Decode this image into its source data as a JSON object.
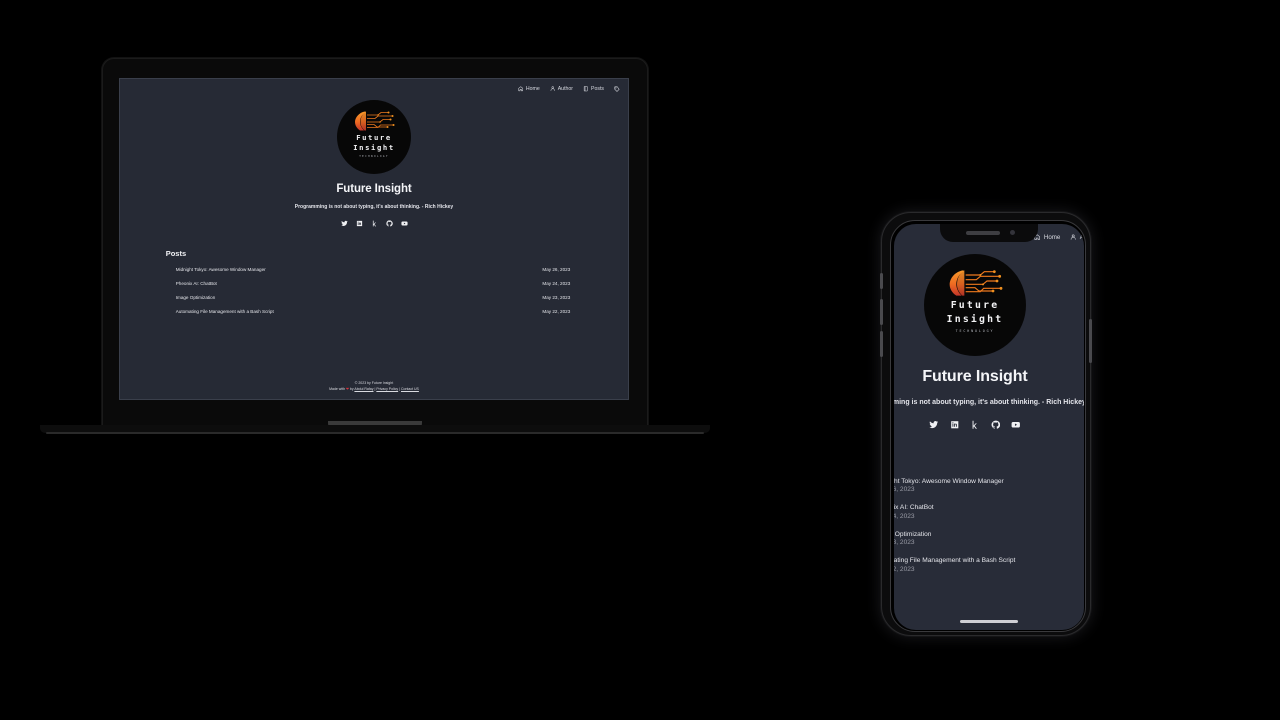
{
  "scene": {
    "background_color": "#000000",
    "devices": [
      "laptop",
      "phone"
    ]
  },
  "site": {
    "background_color": "#262a35",
    "accent_color": "#ef6c24",
    "text_color": "#e8e9ed",
    "nav": {
      "items": [
        {
          "label": "Home",
          "icon": "home-icon"
        },
        {
          "label": "Author",
          "icon": "user-icon"
        },
        {
          "label": "Posts",
          "icon": "book-icon"
        },
        {
          "label": "",
          "icon": "tag-icon"
        }
      ]
    },
    "logo": {
      "line1": "Future",
      "line2": "Insight",
      "line3": "TECHNOLOGY",
      "mark": "face-circuit-icon",
      "badge_color": "#070707"
    },
    "header": {
      "title": "Future Insight",
      "tagline": "Programming is not about typing, it's about thinking. - Rich Hickey"
    },
    "socials": [
      {
        "name": "twitter-icon"
      },
      {
        "name": "linkedin-icon"
      },
      {
        "name": "kaggle-icon"
      },
      {
        "name": "github-icon"
      },
      {
        "name": "youtube-icon"
      }
    ],
    "posts": {
      "heading": "Posts",
      "items": [
        {
          "title": "Midnight Tokyo: Awesome Window Manager",
          "date": "May 26, 2023"
        },
        {
          "title": "Pheonix AI: ChatBot",
          "date": "May 24, 2023"
        },
        {
          "title": "Image Optimization",
          "date": "May 23, 2023"
        },
        {
          "title": "Automating File Management with a Bash Script",
          "date": "May 22, 2023"
        }
      ]
    },
    "footer": {
      "copyright": "© 2023 by Future Insight",
      "made_with_prefix": "Made with ",
      "heart": "❤",
      "made_with_by": " by ",
      "author": "Abdul Rafay",
      "sep1": " | ",
      "privacy": "Privacy Policy",
      "sep2": " | ",
      "contact": "Contact US"
    }
  }
}
